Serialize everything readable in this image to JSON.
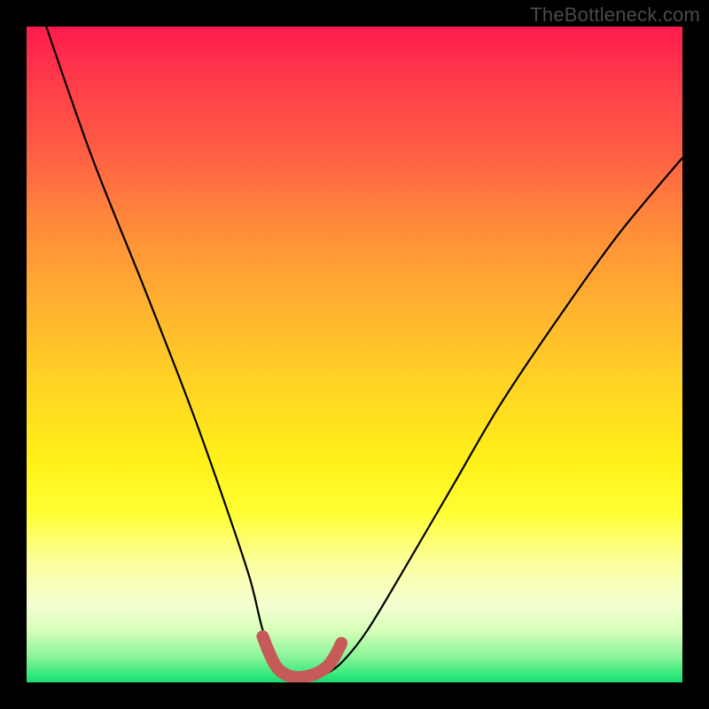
{
  "watermark": "TheBottleneck.com",
  "chart_data": {
    "type": "line",
    "title": "",
    "xlabel": "",
    "ylabel": "",
    "xlim": [
      0,
      100
    ],
    "ylim": [
      0,
      100
    ],
    "series": [
      {
        "name": "bottleneck-curve",
        "x": [
          3,
          10,
          18,
          25,
          30,
          34,
          36,
          38,
          39.5,
          41,
          43,
          45,
          48,
          52,
          58,
          65,
          72,
          80,
          90,
          100
        ],
        "y": [
          100,
          80,
          60,
          42,
          28,
          16,
          8,
          3,
          1,
          0.5,
          0.5,
          1,
          3,
          8,
          18,
          30,
          42,
          54,
          68,
          80
        ]
      },
      {
        "name": "valley-marker",
        "x": [
          36,
          37,
          38,
          39,
          40,
          41,
          42,
          43,
          44,
          45,
          46,
          47,
          48
        ],
        "y": [
          7,
          4.5,
          2.5,
          1.5,
          1,
          0.8,
          0.8,
          1,
          1.3,
          1.8,
          2.6,
          4,
          6
        ]
      }
    ],
    "colors": {
      "curve": "#000000",
      "marker": "#c65a58",
      "gradient_top": "#ff1a4d",
      "gradient_bottom": "#1bd86f"
    }
  }
}
